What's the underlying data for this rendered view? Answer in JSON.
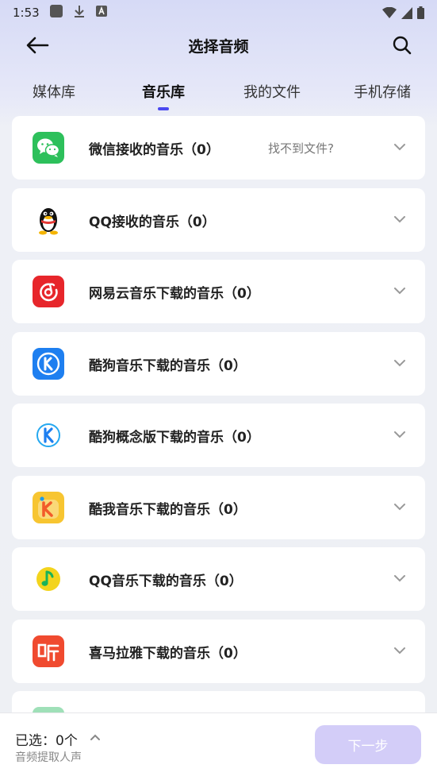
{
  "status_bar": {
    "time": "1:53",
    "icons": [
      "square-notification-icon",
      "download-icon",
      "a-badge-icon",
      "wifi-icon",
      "signal-icon",
      "battery-icon"
    ]
  },
  "app_bar": {
    "title": "选择音频",
    "back_icon": "arrow-left-icon",
    "search_icon": "search-icon"
  },
  "tabs": [
    {
      "label": "媒体库",
      "active": false
    },
    {
      "label": "音乐库",
      "active": true
    },
    {
      "label": "我的文件",
      "active": false
    },
    {
      "label": "手机存储",
      "active": false
    }
  ],
  "sources": [
    {
      "label": "微信接收的音乐（0）",
      "icon": "wechat-icon",
      "hint": "找不到文件?"
    },
    {
      "label": "QQ接收的音乐（0）",
      "icon": "qq-penguin-icon"
    },
    {
      "label": "网易云音乐下载的音乐（0）",
      "icon": "netease-music-icon"
    },
    {
      "label": "酷狗音乐下载的音乐（0）",
      "icon": "kugou-icon"
    },
    {
      "label": "酷狗概念版下载的音乐（0）",
      "icon": "kugou-concept-icon"
    },
    {
      "label": "酷我音乐下载的音乐（0）",
      "icon": "kuwo-icon"
    },
    {
      "label": "QQ音乐下载的音乐（0）",
      "icon": "qq-music-icon"
    },
    {
      "label": "喜马拉雅下载的音乐（0）",
      "icon": "ximalaya-icon"
    }
  ],
  "bottom": {
    "selected": "已选：0个",
    "note": "音频提取人声",
    "next_label": "下一步"
  },
  "colors": {
    "accent": "#4a48f0",
    "next_button_disabled": "#d3cdf8",
    "wechat_green": "#2dc05b",
    "netease_red": "#e7262b",
    "kugou_blue": "#1e7ff0",
    "kuwo_yellow": "#f7c531",
    "qqmusic_yellow": "#f3d41d",
    "ximalaya_red": "#f04a2f"
  }
}
